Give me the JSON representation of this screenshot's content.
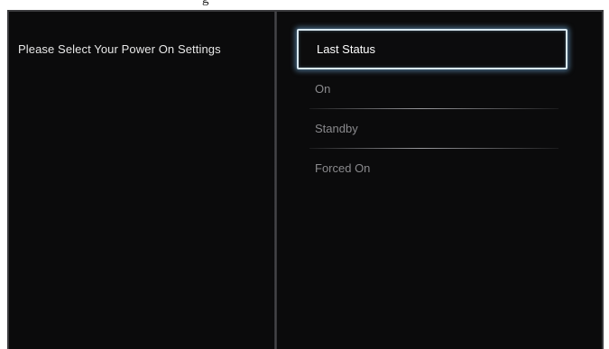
{
  "top_partial_text": "g",
  "prompt": "Please Select Your Power On Settings",
  "options": [
    {
      "label": "Last Status",
      "selected": true
    },
    {
      "label": "On",
      "selected": false
    },
    {
      "label": "Standby",
      "selected": false
    },
    {
      "label": "Forced On",
      "selected": false
    }
  ],
  "colors": {
    "background": "#0b0b0c",
    "selection_glow": "#78b4e6",
    "text_active": "#ffffff",
    "text_inactive": "#8a8a8d"
  }
}
